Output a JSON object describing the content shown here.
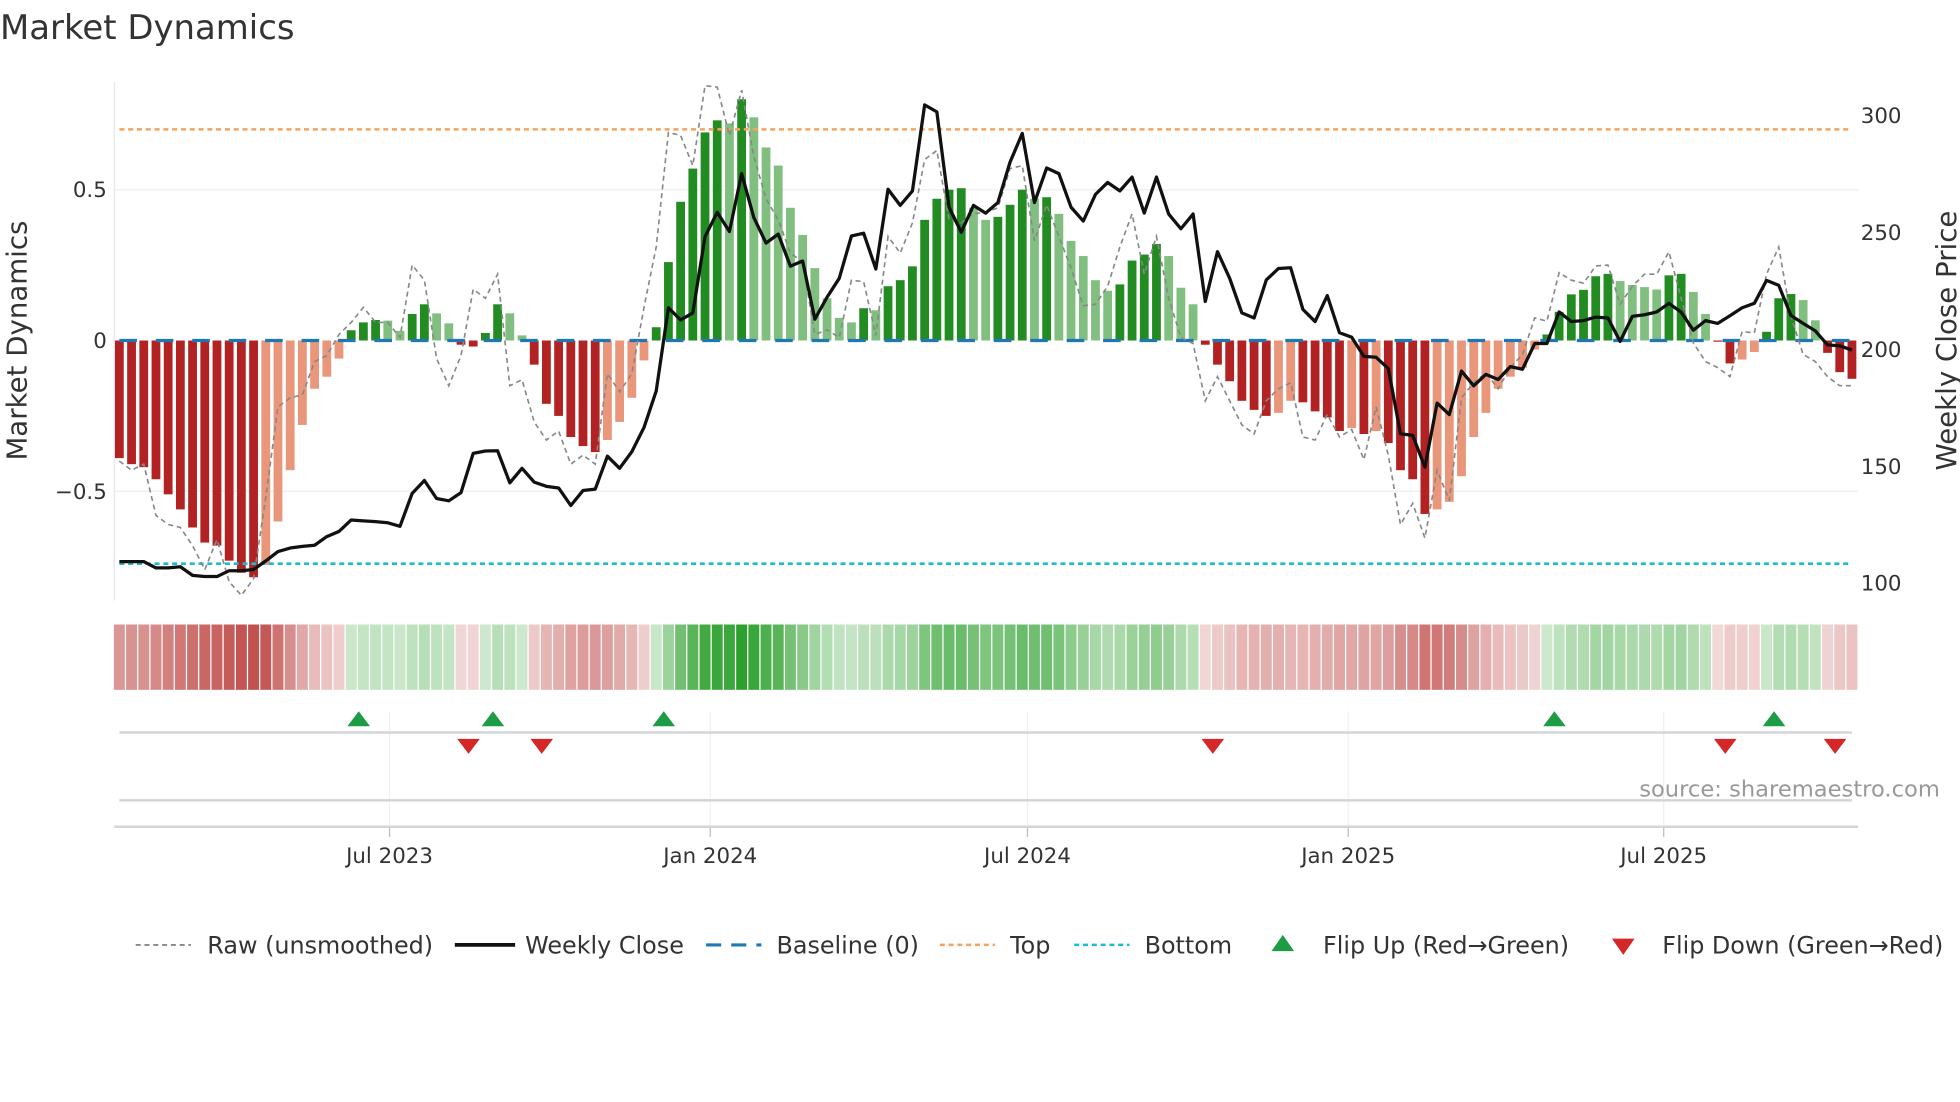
{
  "chart_data": {
    "type": "bar",
    "title": "Market Dynamics",
    "ylabel": "Market Dynamics",
    "y2label": "Weekly Close Price",
    "source": "source: sharemaestro.com",
    "frequency": "weekly",
    "start_date": "2023-01-27",
    "ylim": [
      -0.8625,
      0.858
    ],
    "y2lim": [
      92.5,
      314.5
    ],
    "yticks": [
      {
        "v": -0.5,
        "label": "−0.5"
      },
      {
        "v": 0,
        "label": "0"
      },
      {
        "v": 0.5,
        "label": "0.5"
      }
    ],
    "y2ticks": [
      {
        "v": 100,
        "label": "100"
      },
      {
        "v": 150,
        "label": "150"
      },
      {
        "v": 200,
        "label": "200"
      },
      {
        "v": 250,
        "label": "250"
      },
      {
        "v": 300,
        "label": "300"
      }
    ],
    "xticks": [
      {
        "date": "2023-07-01",
        "label": "Jul 2023"
      },
      {
        "date": "2024-01-01",
        "label": "Jan 2024"
      },
      {
        "date": "2024-07-01",
        "label": "Jul 2024"
      },
      {
        "date": "2025-01-01",
        "label": "Jan 2025"
      },
      {
        "date": "2025-07-01",
        "label": "Jul 2025"
      }
    ],
    "top": 0.7,
    "bottom": -0.74,
    "baseline": 0,
    "dynamics": [
      -0.39,
      -0.41,
      -0.42,
      -0.46,
      -0.51,
      -0.56,
      -0.62,
      -0.67,
      -0.68,
      -0.73,
      -0.77,
      -0.785,
      -0.744,
      -0.6,
      -0.43,
      -0.28,
      -0.16,
      -0.12,
      -0.06,
      0.034,
      0.06,
      0.068,
      0.066,
      0.032,
      0.088,
      0.12,
      0.09,
      0.057,
      -0.014,
      -0.02,
      0.025,
      0.12,
      0.09,
      0.017,
      -0.08,
      -0.21,
      -0.25,
      -0.32,
      -0.35,
      -0.37,
      -0.33,
      -0.27,
      -0.19,
      -0.066,
      0.044,
      0.26,
      0.46,
      0.57,
      0.69,
      0.73,
      0.72,
      0.8,
      0.74,
      0.64,
      0.58,
      0.44,
      0.35,
      0.24,
      0.14,
      0.075,
      0.06,
      0.107,
      0.1,
      0.18,
      0.2,
      0.246,
      0.4,
      0.47,
      0.5,
      0.505,
      0.44,
      0.4,
      0.41,
      0.45,
      0.5,
      0.47,
      0.475,
      0.42,
      0.33,
      0.28,
      0.2,
      0.165,
      0.186,
      0.265,
      0.285,
      0.32,
      0.28,
      0.175,
      0.12,
      -0.014,
      -0.08,
      -0.135,
      -0.2,
      -0.23,
      -0.25,
      -0.24,
      -0.2,
      -0.205,
      -0.235,
      -0.255,
      -0.3,
      -0.29,
      -0.31,
      -0.3,
      -0.34,
      -0.43,
      -0.46,
      -0.575,
      -0.56,
      -0.535,
      -0.45,
      -0.32,
      -0.24,
      -0.16,
      -0.12,
      -0.09,
      -0.03,
      0.02,
      0.095,
      0.153,
      0.168,
      0.213,
      0.221,
      0.197,
      0.184,
      0.177,
      0.169,
      0.216,
      0.221,
      0.161,
      0.088,
      -0.004,
      -0.076,
      -0.063,
      -0.038,
      0.029,
      0.14,
      0.154,
      0.134,
      0.067,
      -0.041,
      -0.105,
      -0.127
    ],
    "raw": [
      -0.4,
      -0.43,
      -0.41,
      -0.58,
      -0.61,
      -0.62,
      -0.68,
      -0.76,
      -0.66,
      -0.8,
      -0.845,
      -0.79,
      -0.52,
      -0.22,
      -0.19,
      -0.18,
      -0.07,
      -0.05,
      0.02,
      0.06,
      0.11,
      0.06,
      0.06,
      0.01,
      0.25,
      0.2,
      -0.06,
      -0.15,
      -0.05,
      0.17,
      0.14,
      0.22,
      -0.15,
      -0.13,
      -0.27,
      -0.33,
      -0.3,
      -0.41,
      -0.38,
      -0.41,
      -0.11,
      -0.17,
      -0.11,
      0.11,
      0.31,
      0.69,
      0.68,
      0.58,
      0.845,
      0.84,
      0.68,
      0.83,
      0.61,
      0.47,
      0.4,
      0.29,
      0.26,
      0.02,
      0.035,
      0.01,
      0.2,
      0.195,
      0.017,
      0.345,
      0.29,
      0.39,
      0.6,
      0.63,
      0.4,
      0.39,
      0.42,
      0.425,
      0.44,
      0.57,
      0.58,
      0.33,
      0.45,
      0.345,
      0.24,
      0.115,
      0.12,
      0.18,
      0.31,
      0.42,
      0.22,
      0.345,
      0.14,
      0.01,
      -0.01,
      -0.2,
      -0.12,
      -0.2,
      -0.28,
      -0.31,
      -0.2,
      -0.16,
      -0.14,
      -0.32,
      -0.33,
      -0.245,
      -0.32,
      -0.295,
      -0.395,
      -0.22,
      -0.38,
      -0.61,
      -0.54,
      -0.655,
      -0.43,
      -0.53,
      -0.19,
      -0.14,
      -0.107,
      -0.16,
      -0.09,
      -0.046,
      0.075,
      0.064,
      0.225,
      0.2,
      0.19,
      0.247,
      0.25,
      0.12,
      0.18,
      0.22,
      0.22,
      0.294,
      0.14,
      -0.008,
      -0.07,
      -0.09,
      -0.12,
      0.03,
      0.025,
      0.22,
      0.31,
      0.08,
      -0.046,
      -0.07,
      -0.12,
      -0.15,
      -0.15
    ],
    "close": [
      109.2,
      109.2,
      109.2,
      106.5,
      106.5,
      107,
      103.3,
      102.8,
      102.8,
      105.3,
      105.3,
      105.8,
      109.5,
      113.5,
      115,
      115.7,
      116.2,
      119.9,
      122.1,
      127,
      126.6,
      126.3,
      125.8,
      124.3,
      138.4,
      143.9,
      136.2,
      135.2,
      138.7,
      155.5,
      156.5,
      156.6,
      142.9,
      149.1,
      143.2,
      141.4,
      140.7,
      133.2,
      139.6,
      140.2,
      154.3,
      149.1,
      156.2,
      166.6,
      182.2,
      217.8,
      212.6,
      215.6,
      248.2,
      258.6,
      250.4,
      275.2,
      256.4,
      245.5,
      249.3,
      235.6,
      237.8,
      212.9,
      222.3,
      230.4,
      248.5,
      249.7,
      234.4,
      268.5,
      261.6,
      267.8,
      304.6,
      301.6,
      260.8,
      250.1,
      261.6,
      258.3,
      262.8,
      280.1,
      292.4,
      262.8,
      277.6,
      275.2,
      260.8,
      254.9,
      266.3,
      271.4,
      267.8,
      273.7,
      258.3,
      273.7,
      257.9,
      251.6,
      257.9,
      220.5,
      241.8,
      230.4,
      215.6,
      213.4,
      229.7,
      234.6,
      234.9,
      217.1,
      211.9,
      223.0,
      207.1,
      205.2,
      197.0,
      196.6,
      191.8,
      163.9,
      163.2,
      149.6,
      177.0,
      172.1,
      190.7,
      184.4,
      189.3,
      187.1,
      192.6,
      191.5,
      202.5,
      202.5,
      216.0,
      211.9,
      212.3,
      213.8,
      213.4,
      203.4,
      214.1,
      214.8,
      216.0,
      219.7,
      215.9,
      208.2,
      212.3,
      211.1,
      214.4,
      217.8,
      219.7,
      229.5,
      227.4,
      214.5,
      211.1,
      207.9,
      201.9,
      201.5,
      199.7
    ],
    "legend_position": "bottom",
    "legend": {
      "raw": "Raw (unsmoothed)",
      "close": "Weekly Close",
      "baseline": "Baseline (0)",
      "top": "Top",
      "bottom": "Bottom",
      "flip_up": "Flip Up (Red→Green)",
      "flip_down": "Flip Down (Green→Red)"
    },
    "colors": {
      "strong_green": "#228b22",
      "weak_green": "#80bf80",
      "strong_red": "#b22222",
      "weak_red": "#e9967a",
      "heat_green": "#2ca02c",
      "heat_red": "#c0504d",
      "close": "#111111",
      "raw": "#888888",
      "baseline": "#1f77b4",
      "top": "#f4a460",
      "bottom": "#17becf",
      "flip_up": "#1e9c45",
      "flip_down": "#d62728"
    }
  }
}
